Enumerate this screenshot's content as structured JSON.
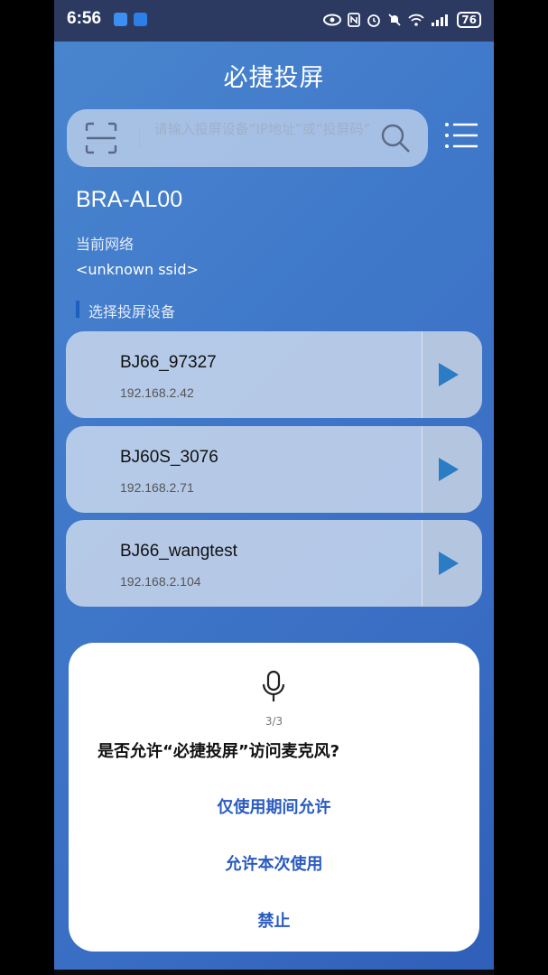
{
  "status_bar": {
    "time": "6:56",
    "battery": "76"
  },
  "header": {
    "title": "必捷投屏"
  },
  "search": {
    "placeholder": "请输入投屏设备“IP地址”或“投屏码”"
  },
  "device": {
    "name": "BRA-AL00",
    "network_label": "当前网络",
    "ssid": "<unknown ssid>"
  },
  "list": {
    "section_title": "选择投屏设备",
    "items": [
      {
        "name": "BJ66_97327",
        "ip": "192.168.2.42"
      },
      {
        "name": "BJ60S_3076",
        "ip": "192.168.2.71"
      },
      {
        "name": "BJ66_wangtest",
        "ip": "192.168.2.104"
      }
    ]
  },
  "dialog": {
    "counter": "3/3",
    "question": "是否允许“必捷投屏”访问麦克风?",
    "options": {
      "allow_while_using": "仅使用期间允许",
      "allow_once": "允许本次使用",
      "deny": "禁止"
    }
  },
  "colors": {
    "accent": "#2a5bc0",
    "play": "#2a7cc4"
  }
}
